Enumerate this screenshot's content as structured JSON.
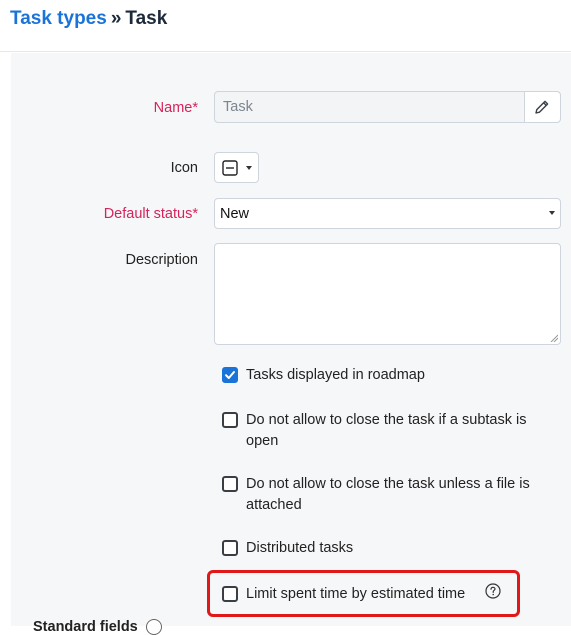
{
  "breadcrumb": {
    "parent": "Task types",
    "separator": "»",
    "current": "Task"
  },
  "form": {
    "name": {
      "label": "Name*",
      "value": "Task"
    },
    "icon": {
      "label": "Icon"
    },
    "default_status": {
      "label": "Default status*",
      "value": "New"
    },
    "description": {
      "label": "Description",
      "value": ""
    }
  },
  "options": [
    {
      "label": "Tasks displayed in roadmap",
      "checked": true
    },
    {
      "label": "Do not allow to close the task if a subtask is open",
      "checked": false
    },
    {
      "label": "Do not allow to close the task unless a file is attached",
      "checked": false
    },
    {
      "label": "Distributed tasks",
      "checked": false
    },
    {
      "label": "Limit spent time by estimated time",
      "checked": false
    }
  ],
  "section": {
    "standard_fields": "Standard fields"
  },
  "colors": {
    "accent": "#1a73d9",
    "required": "#d6245a",
    "highlight": "#e01818"
  }
}
